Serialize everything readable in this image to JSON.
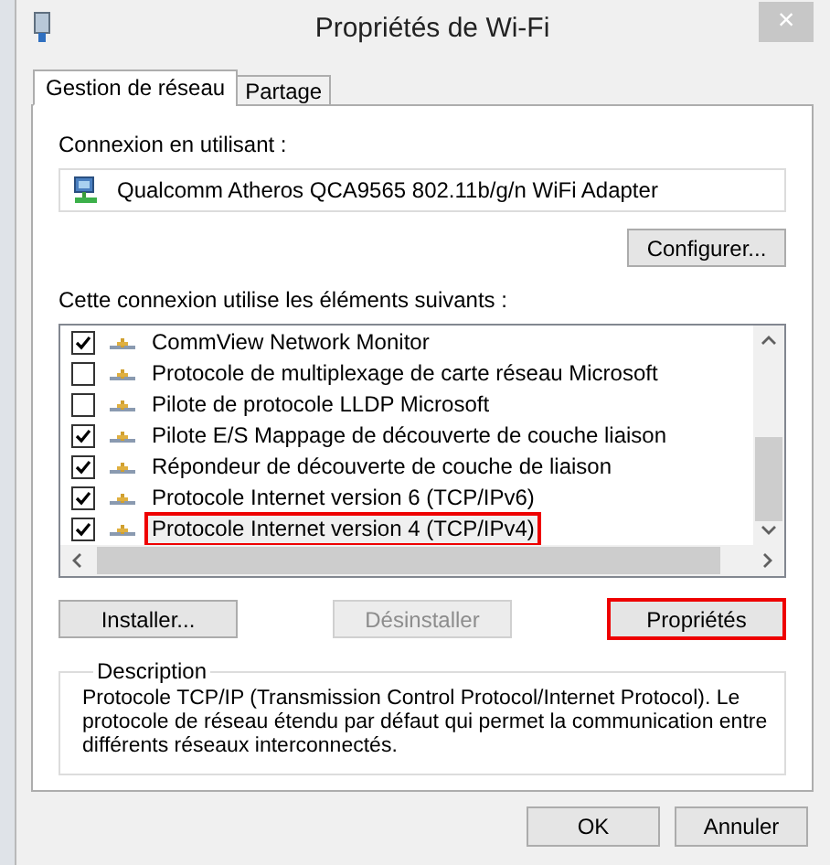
{
  "window": {
    "title": "Propriétés de Wi-Fi",
    "close_label": "×"
  },
  "tabs": [
    {
      "label": "Gestion de réseau",
      "selected": true
    },
    {
      "label": "Partage",
      "selected": false
    }
  ],
  "connection_label": "Connexion en utilisant :",
  "adapter": "Qualcomm Atheros QCA9565 802.11b/g/n WiFi Adapter",
  "configure_button": "Configurer...",
  "components_label": "Cette connexion utilise les éléments suivants :",
  "components": [
    {
      "name": "CommView Network Monitor",
      "checked": true,
      "selected": false,
      "highlighted": false
    },
    {
      "name": "Protocole de multiplexage de carte réseau Microsoft",
      "checked": false,
      "selected": false,
      "highlighted": false
    },
    {
      "name": "Pilote de protocole LLDP Microsoft",
      "checked": false,
      "selected": false,
      "highlighted": false
    },
    {
      "name": "Pilote E/S Mappage de découverte de couche liaison",
      "checked": true,
      "selected": false,
      "highlighted": false
    },
    {
      "name": "Répondeur de découverte de couche de liaison",
      "checked": true,
      "selected": false,
      "highlighted": false
    },
    {
      "name": "Protocole Internet version 6 (TCP/IPv6)",
      "checked": true,
      "selected": false,
      "highlighted": false
    },
    {
      "name": "Protocole Internet version 4 (TCP/IPv4)",
      "checked": true,
      "selected": true,
      "highlighted": true
    }
  ],
  "buttons": [
    {
      "label": "Installer...",
      "disabled": false,
      "highlighted": false
    },
    {
      "label": "Désinstaller",
      "disabled": true,
      "highlighted": false
    },
    {
      "label": "Propriétés",
      "disabled": false,
      "highlighted": true
    }
  ],
  "description": {
    "title": "Description",
    "text": "Protocole TCP/IP (Transmission Control Protocol/Internet Protocol). Le protocole de réseau étendu par défaut qui permet la communication entre différents réseaux interconnectés."
  },
  "dialog_buttons": [
    {
      "label": "OK"
    },
    {
      "label": "Annuler"
    }
  ]
}
